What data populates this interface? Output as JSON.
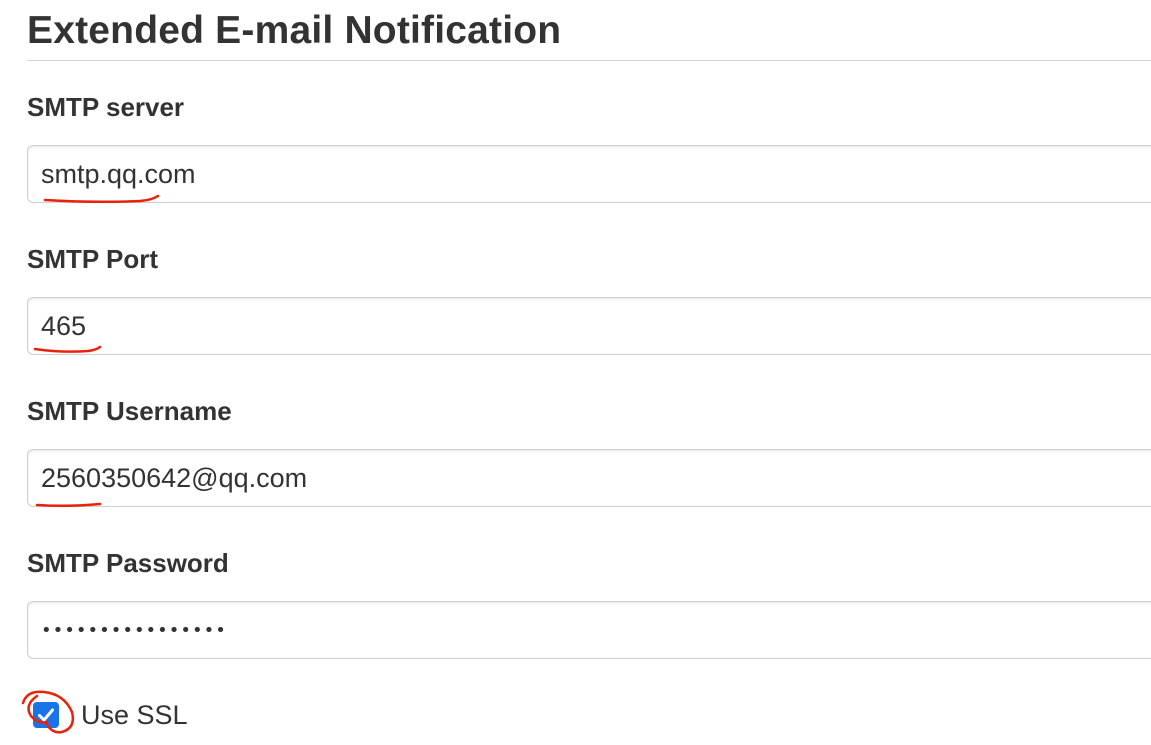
{
  "section": {
    "title": "Extended E-mail Notification"
  },
  "fields": {
    "smtp_server": {
      "label": "SMTP server",
      "value": "smtp.qq.com"
    },
    "smtp_port": {
      "label": "SMTP Port",
      "value": "465"
    },
    "smtp_username": {
      "label": "SMTP Username",
      "value": "2560350642@qq.com"
    },
    "smtp_password": {
      "label": "SMTP Password",
      "value": "••••••••••••••••"
    }
  },
  "use_ssl": {
    "label": "Use SSL",
    "checked": true
  },
  "colors": {
    "text": "#333333",
    "checkbox_accent": "#1a73e8",
    "annotation_red": "#e8230c",
    "input_border": "#cfcfcf"
  },
  "icons": {
    "checkbox_mark": "checkmark-icon"
  }
}
